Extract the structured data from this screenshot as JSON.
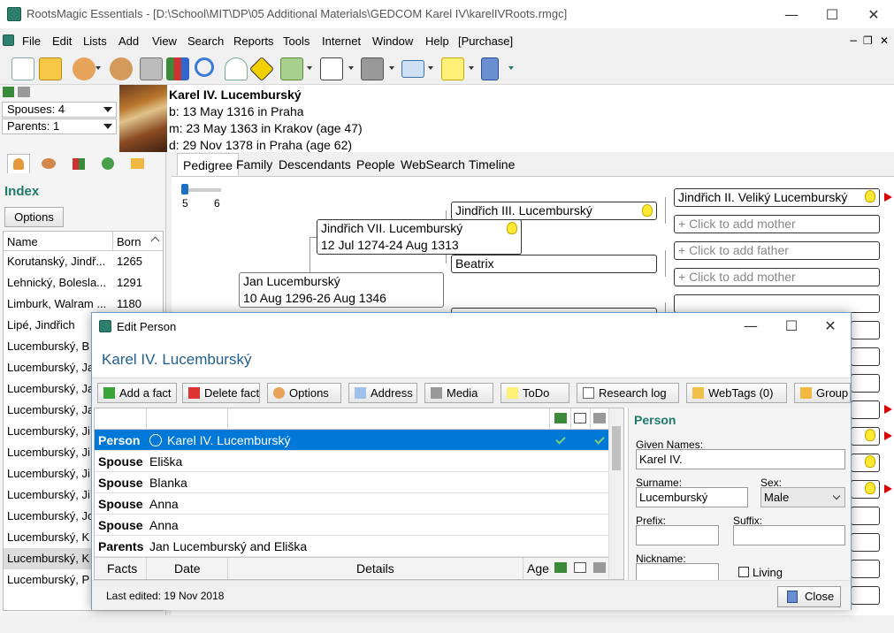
{
  "window": {
    "title": "RootsMagic Essentials - [D:\\School\\MIT\\DP\\05 Additional Materials\\GEDCOM Karel IV\\karelIVRoots.rmgc]",
    "min": "—",
    "max": "☐",
    "close": "✕"
  },
  "menu": [
    "File",
    "Edit",
    "Lists",
    "Add",
    "View",
    "Search",
    "Reports",
    "Tools",
    "Internet",
    "Window",
    "Help",
    "[Purchase]"
  ],
  "mdi_controls": {
    "min": "−",
    "restore": "❐",
    "close": "✕"
  },
  "left": {
    "spouses": "Spouses: 4",
    "parents": "Parents: 1",
    "index_title": "Index",
    "options": "Options",
    "col_name": "Name",
    "col_born": "Born",
    "rows": [
      {
        "name": "Korutanský, Jindř...",
        "born": "1265"
      },
      {
        "name": "Lehnický, Bolesla...",
        "born": "1291"
      },
      {
        "name": "Limburk, Walram ...",
        "born": "1180"
      },
      {
        "name": "Lipé, Jindřich",
        "born": ""
      },
      {
        "name": "Lucemburský, B",
        "born": ""
      },
      {
        "name": "Lucemburský, Ja",
        "born": ""
      },
      {
        "name": "Lucemburský, Ja",
        "born": ""
      },
      {
        "name": "Lucemburský, Ja",
        "born": ""
      },
      {
        "name": "Lucemburský, Ji",
        "born": ""
      },
      {
        "name": "Lucemburský, Ji",
        "born": ""
      },
      {
        "name": "Lucemburský, Ji",
        "born": ""
      },
      {
        "name": "Lucemburský, Ji",
        "born": ""
      },
      {
        "name": "Lucemburský, Jo",
        "born": ""
      },
      {
        "name": "Lucemburský, K",
        "born": ""
      },
      {
        "name": "Lucemburský, K",
        "born": ""
      },
      {
        "name": "Lucemburský, P",
        "born": ""
      }
    ]
  },
  "person": {
    "name": "Karel IV. Lucemburský",
    "birth": "b: 13 May 1316 in Praha",
    "marriage": "m: 23 May 1363 in Krakov (age 47)",
    "death": "d: 29 Nov 1378 in Praha (age 62)"
  },
  "view_tabs": [
    "Pedigree",
    "Family",
    "Descendants",
    "People",
    "WebSearch",
    "Timeline"
  ],
  "pedigree": {
    "gen_min": "5",
    "gen_max": "6",
    "father": {
      "name": "Jan Lucemburský",
      "dates": "10 Aug 1296-26 Aug 1346"
    },
    "grandfather": {
      "name": "Jindřich VII. Lucemburský",
      "dates": "12 Jul 1274-24 Aug 1313"
    },
    "ggf": "Jindřich III. Lucemburský",
    "ggm": "Beatrix",
    "gggf": "Jindřich II. Veliký Lucemburský",
    "add_mother": "+ Click to add mother",
    "add_father": "+ Click to add father"
  },
  "dialog": {
    "title": "Edit Person",
    "person_name": "Karel IV. Lucemburský",
    "buttons": [
      "Add a fact",
      "Delete fact",
      "Options",
      "Address",
      "Media",
      "ToDo",
      "Research log",
      "WebTags (0)",
      "Group"
    ],
    "rows": [
      {
        "type": "Person",
        "detail": "Karel IV. Lucemburský"
      },
      {
        "type": "Spouse",
        "detail": "Eliška"
      },
      {
        "type": "Spouse",
        "detail": "Blanka"
      },
      {
        "type": "Spouse",
        "detail": "Anna"
      },
      {
        "type": "Spouse",
        "detail": "Anna"
      },
      {
        "type": "Parents",
        "detail": "Jan Lucemburský and Eliška"
      }
    ],
    "col_facts": "Facts",
    "col_date": "Date",
    "col_details": "Details",
    "col_age": "Age",
    "form": {
      "title": "Person",
      "given_label": "Given Names:",
      "given": "Karel IV.",
      "surname_label": "Surname:",
      "surname": "Lucemburský",
      "sex_label": "Sex:",
      "sex": "Male",
      "prefix_label": "Prefix:",
      "suffix_label": "Suffix:",
      "nickname_label": "Nickname:",
      "living_label": "Living"
    },
    "last_edited": "Last edited: 19 Nov 2018",
    "close": "Close"
  },
  "colors": {
    "accent": "#1e7a6a",
    "selection": "#0078d7",
    "name_blue": "#1f5e8e"
  }
}
